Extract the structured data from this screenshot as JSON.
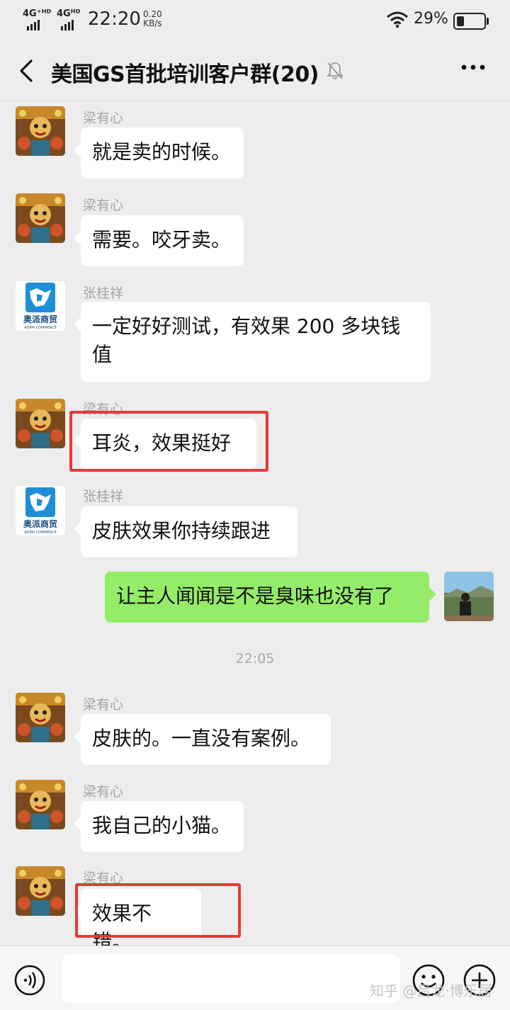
{
  "status": {
    "sig1": "4G⁺ᴴᴰ",
    "sig2": "4Gᴴᴰ",
    "time": "22:20",
    "speed_value": "0.20",
    "speed_unit": "KB/s",
    "battery": "29%"
  },
  "header": {
    "title": "美国GS首批培训客户群(20)",
    "back_icon": "chevron-left-icon",
    "mute_icon": "bell-muted-icon",
    "more_icon": "more-dots-icon"
  },
  "messages": [
    {
      "sender": "梁有心",
      "text": "就是卖的时候。"
    },
    {
      "sender": "梁有心",
      "text": "需要。咬牙卖。"
    },
    {
      "sender": "张桂祥",
      "text": "一定好好测试，有效果 200 多块钱值"
    },
    {
      "sender": "梁有心",
      "text": "耳炎，效果挺好"
    },
    {
      "sender": "张桂祥",
      "text": "皮肤效果你持续跟进"
    },
    {
      "sender": "",
      "text": "让主人闻闻是不是臭味也没有了"
    },
    {
      "sender": "梁有心",
      "text": "皮肤的。一直没有案例。"
    },
    {
      "sender": "梁有心",
      "text": "我自己的小猫。"
    },
    {
      "sender": "梁有心",
      "text": "效果不错。"
    }
  ],
  "timestamp": "22:05",
  "logo": {
    "brand": "奥派商贸",
    "sub": "AOPAI COMMERCE"
  },
  "input": {
    "voice_icon": "voice-icon",
    "emoji_icon": "emoji-icon",
    "plus_icon": "plus-icon"
  },
  "watermark": "知乎 @吕龙·博乐居",
  "colors": {
    "background": "#ededed",
    "bubble_self": "#95ec69",
    "bubble_other": "#ffffff",
    "highlight_box": "#e53a3a"
  }
}
